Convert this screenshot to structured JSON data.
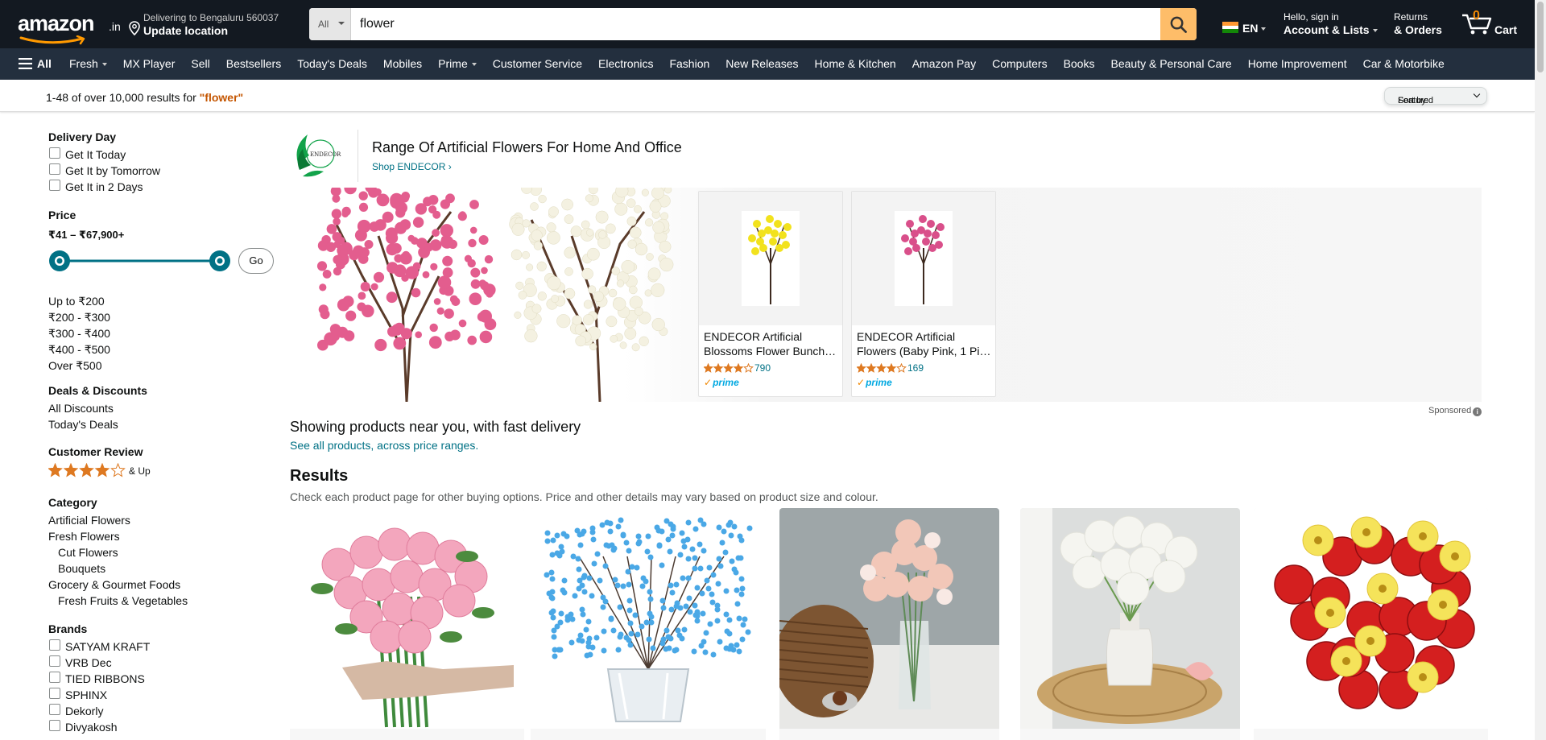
{
  "header": {
    "logo_text": "amazon",
    "logo_tld": ".in",
    "deliver_line1": "Delivering to Bengaluru 560037",
    "deliver_line2": "Update location",
    "search_category": "All",
    "search_value": "flower",
    "lang": "EN",
    "account_line1": "Hello, sign in",
    "account_line2": "Account & Lists",
    "returns_line1": "Returns",
    "returns_line2": "& Orders",
    "cart_count": "0",
    "cart_label": "Cart"
  },
  "subnav": {
    "all_label": "All",
    "items": [
      {
        "label": "Fresh",
        "dropdown": true
      },
      {
        "label": "MX Player",
        "dropdown": false
      },
      {
        "label": "Sell",
        "dropdown": false
      },
      {
        "label": "Bestsellers",
        "dropdown": false
      },
      {
        "label": "Today's Deals",
        "dropdown": false
      },
      {
        "label": "Mobiles",
        "dropdown": false
      },
      {
        "label": "Prime",
        "dropdown": true
      },
      {
        "label": "Customer Service",
        "dropdown": false
      },
      {
        "label": "Electronics",
        "dropdown": false
      },
      {
        "label": "Fashion",
        "dropdown": false
      },
      {
        "label": "New Releases",
        "dropdown": false
      },
      {
        "label": "Home & Kitchen",
        "dropdown": false
      },
      {
        "label": "Amazon Pay",
        "dropdown": false
      },
      {
        "label": "Computers",
        "dropdown": false
      },
      {
        "label": "Books",
        "dropdown": false
      },
      {
        "label": "Beauty & Personal Care",
        "dropdown": false
      },
      {
        "label": "Home Improvement",
        "dropdown": false
      },
      {
        "label": "Car & Motorbike",
        "dropdown": false
      }
    ]
  },
  "results_bar": {
    "prefix": "1-48 of over 10,000 results for ",
    "query": "\"flower\"",
    "sort_label": "Sort by:",
    "sort_value": "Featured"
  },
  "sidebar": {
    "delivery_title": "Delivery Day",
    "delivery_options": [
      "Get It Today",
      "Get It by Tomorrow",
      "Get It in 2 Days"
    ],
    "price_title": "Price",
    "price_range": "₹41 – ₹67,900+",
    "go_label": "Go",
    "price_links": [
      "Up to ₹200",
      "₹200 - ₹300",
      "₹300 - ₹400",
      "₹400 - ₹500",
      "Over ₹500"
    ],
    "deals_title": "Deals & Discounts",
    "deals_links": [
      "All Discounts",
      "Today's Deals"
    ],
    "review_title": "Customer Review",
    "review_stars": 4,
    "review_suffix": "& Up",
    "category_title": "Category",
    "categories": [
      {
        "label": "Artificial Flowers",
        "indent": false
      },
      {
        "label": "Fresh Flowers",
        "indent": false
      },
      {
        "label": "Cut Flowers",
        "indent": true
      },
      {
        "label": "Bouquets",
        "indent": true
      },
      {
        "label": "Grocery & Gourmet Foods",
        "indent": false
      },
      {
        "label": "Fresh Fruits & Vegetables",
        "indent": true
      }
    ],
    "brands_title": "Brands",
    "brands": [
      "SATYAM KRAFT",
      "VRB Dec",
      "TIED RIBBONS",
      "SPHINX",
      "Dekorly",
      "Divyakosh"
    ]
  },
  "brand_banner": {
    "logo_text": "ENDECOR",
    "title": "Range Of Artificial Flowers For Home And Office",
    "shop_link": "Shop ENDECOR ›",
    "cards": [
      {
        "title": "ENDECOR Artificial Blossoms Flower Bunch…",
        "reviews": "790",
        "stars": 4,
        "flower_color": "#f2e21d",
        "prime": "prime"
      },
      {
        "title": "ENDECOR Artificial Flowers (Baby Pink, 1 Pi…",
        "reviews": "169",
        "stars": 4,
        "flower_color": "#d94f8a",
        "prime": "prime"
      }
    ],
    "sponsored": "Sponsored",
    "info_glyph": "i"
  },
  "near_you": {
    "title": "Showing products near you, with fast delivery",
    "link": "See all products, across price ranges."
  },
  "results": {
    "title": "Results",
    "subtitle": "Check each product page for other buying options. Price and other details may vary based on product size and colour."
  },
  "products": [
    {
      "name": "pink-roses-bouquet",
      "color": "#f3a6bd"
    },
    {
      "name": "blue-gypsophila-vase",
      "color": "#4aa8e6"
    },
    {
      "name": "peony-vase-on-table",
      "color": "#f2c7b8"
    },
    {
      "name": "white-chrysanthemum-vase",
      "color": "#f5f5f0"
    },
    {
      "name": "red-roses-yellow-gerbera",
      "color": "#d41f1f"
    }
  ],
  "colors": {
    "nav_dark": "#131921",
    "nav_sub": "#232f3e",
    "search_button": "#febd69",
    "link": "#007185",
    "query_orange": "#c45500",
    "star": "#de7921",
    "slider_teal": "#007185"
  }
}
